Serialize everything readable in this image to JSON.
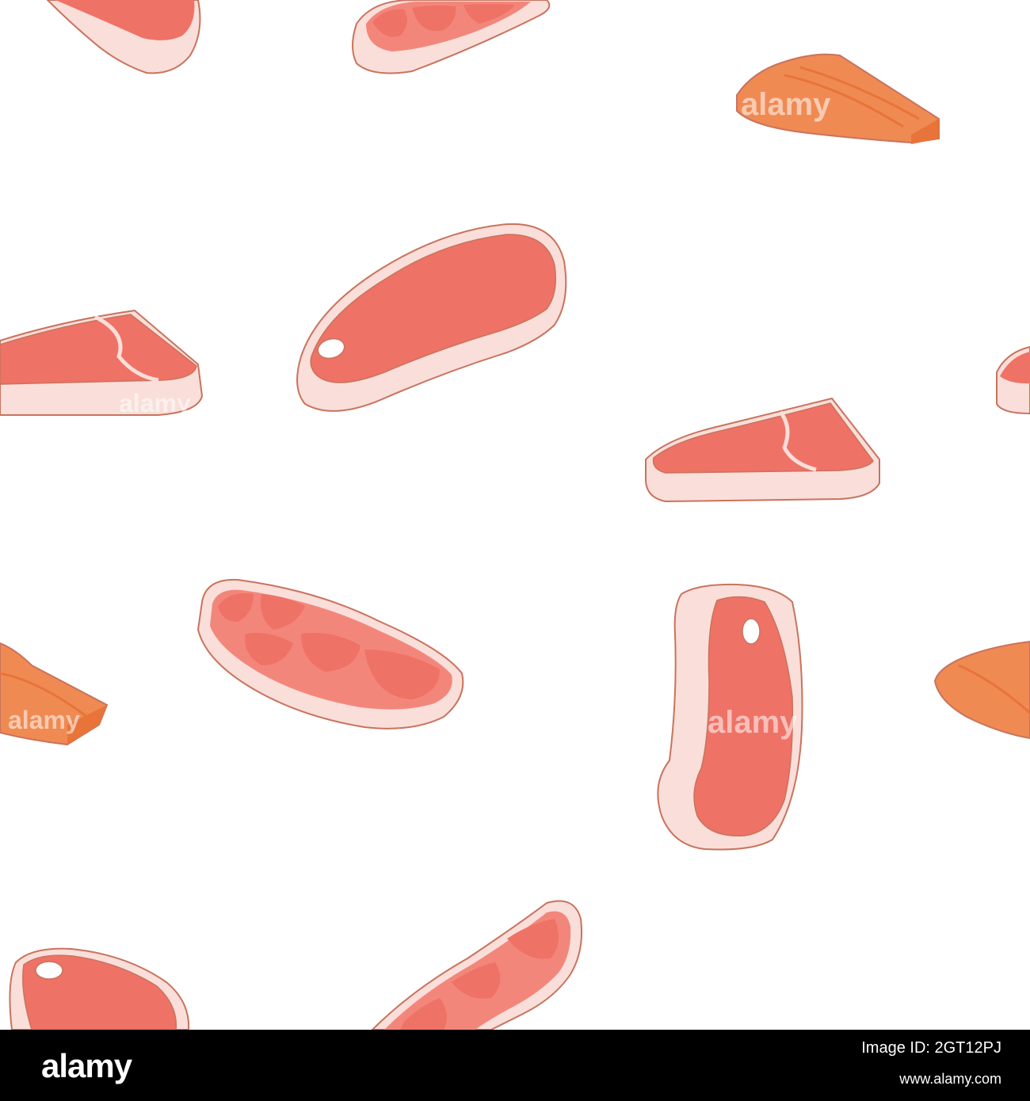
{
  "pattern": {
    "description_type": "seamless-pattern",
    "items": [
      {
        "kind": "steak-marbled"
      },
      {
        "kind": "steak-bone"
      },
      {
        "kind": "steak-t-bone"
      },
      {
        "kind": "salmon-fillet"
      }
    ],
    "colors": {
      "background": "#ffffff",
      "meat_fat": "#f9ded9",
      "meat_red": "#ef7266",
      "meat_mid": "#f3867b",
      "outline": "#c9735d",
      "salmon": "#f08a53",
      "salmon_dark": "#e8743a",
      "bone": "#ffffff"
    },
    "watermark": "alamy"
  },
  "footer": {
    "logo": "alamy",
    "image_id": "Image ID: 2GT12PJ",
    "url": "www.alamy.com"
  }
}
